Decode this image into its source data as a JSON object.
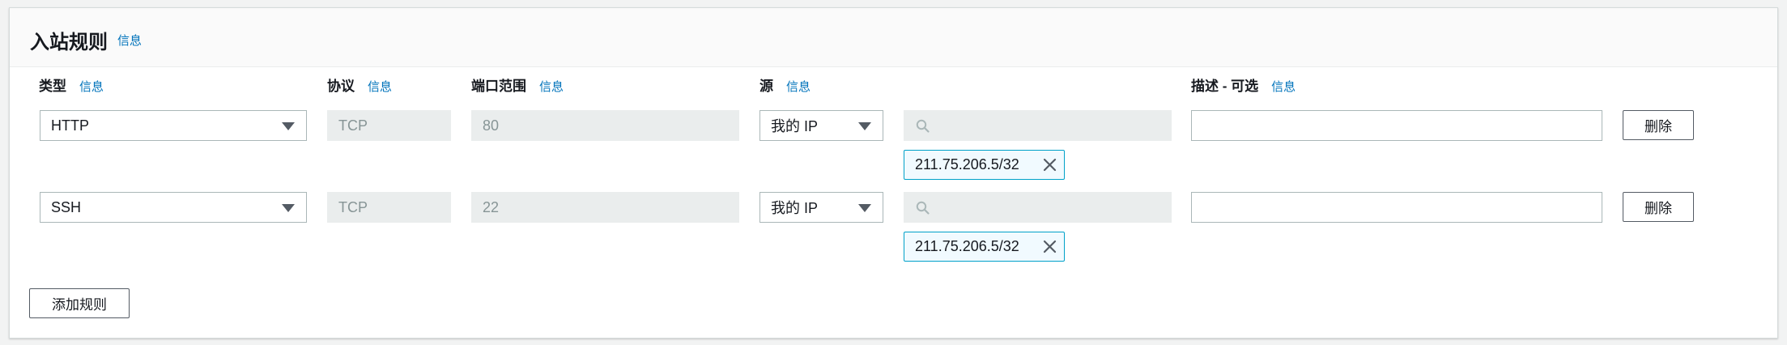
{
  "panel": {
    "title": "入站规则",
    "title_info": "信息"
  },
  "columns": {
    "type": {
      "label": "类型",
      "info": "信息"
    },
    "protocol": {
      "label": "协议",
      "info": "信息"
    },
    "port_range": {
      "label": "端口范围",
      "info": "信息"
    },
    "source": {
      "label": "源",
      "info": "信息"
    },
    "description": {
      "label": "描述 - 可选",
      "info": "信息"
    }
  },
  "rules": [
    {
      "type": "HTTP",
      "protocol": "TCP",
      "port_range": "80",
      "source_type": "我的 IP",
      "source_search_value": "",
      "source_token": "211.75.206.5/32",
      "description": "",
      "delete_label": "删除"
    },
    {
      "type": "SSH",
      "protocol": "TCP",
      "port_range": "22",
      "source_type": "我的 IP",
      "source_search_value": "",
      "source_token": "211.75.206.5/32",
      "description": "",
      "delete_label": "删除"
    }
  ],
  "add_rule_label": "添加规则",
  "icons": {
    "dropdown": "caret-down-icon",
    "search": "search-icon",
    "remove_token": "close-icon"
  },
  "colors": {
    "link": "#0073bb",
    "token_border": "#00a1c9",
    "disabled_bg": "#eaeded"
  }
}
